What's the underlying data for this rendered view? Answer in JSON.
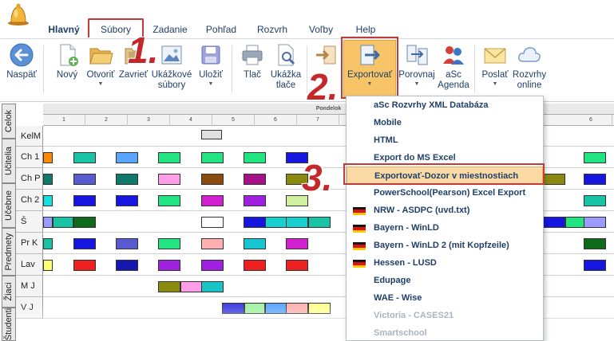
{
  "tabs": [
    {
      "label": "Hlavný",
      "active": true
    },
    {
      "label": "Súbory",
      "highlight": true
    },
    {
      "label": "Zadanie"
    },
    {
      "label": "Pohľad"
    },
    {
      "label": "Rozvrh"
    },
    {
      "label": "Voľby"
    },
    {
      "label": "Help"
    }
  ],
  "toolbar": {
    "back": "Naspäť",
    "new": "Nový",
    "open": "Otvoriť",
    "close": "Zavrieť",
    "sample_line1": "Ukážkové",
    "sample_line2": "súbory",
    "save": "Uložiť",
    "print": "Tlač",
    "preview_line1": "Ukážka",
    "preview_line2": "tlače",
    "export": "Exportovať",
    "compare": "Porovnaj",
    "agenda_line1": "aSc",
    "agenda_line2": "Agenda",
    "send": "Poslať",
    "online_line1": "Rozvrhy",
    "online_line2": "online"
  },
  "steps": [
    "1.",
    "2.",
    "3."
  ],
  "side_tabs": [
    "Celok",
    "Učitelia",
    "Učebne",
    "Predmety",
    "Žiaci",
    "Študenti"
  ],
  "timetable": {
    "day": "Pondelok",
    "periods": [
      "1",
      "2",
      "3",
      "4",
      "5",
      "6",
      "7",
      "6"
    ],
    "rows": [
      "KelM",
      "Ch 1",
      "Ch P",
      "Ch 2",
      "Š",
      "Pr K",
      "Lav K",
      "M J",
      "V J"
    ]
  },
  "export_menu": [
    {
      "label": "aSc Rozvrhy XML Databáza"
    },
    {
      "label": "Mobile"
    },
    {
      "label": "HTML"
    },
    {
      "label": "Export do MS Excel"
    },
    {
      "label": "Exportovať-Dozor v miestnostiach",
      "selected": true
    },
    {
      "label": "PowerSchool(Pearson) Excel Export"
    },
    {
      "label": "NRW - ASDPC (uvd.txt)",
      "flag": "de"
    },
    {
      "label": "Bayern - WinLD",
      "flag": "de"
    },
    {
      "label": "Bayern - WinLD 2 (mit Kopfzeile)",
      "flag": "de"
    },
    {
      "label": "Hessen - LUSD",
      "flag": "de"
    },
    {
      "label": "Edupage"
    },
    {
      "label": "WAE - Wise"
    },
    {
      "label": "Victoria - CASES21",
      "faded": true
    },
    {
      "label": "Smartschool",
      "faded": true
    }
  ],
  "colors": {
    "accent": "#c23a3a",
    "export_button": "#f7c567",
    "menu_selected": "#fbd9a4",
    "link_text": "#20406a"
  }
}
